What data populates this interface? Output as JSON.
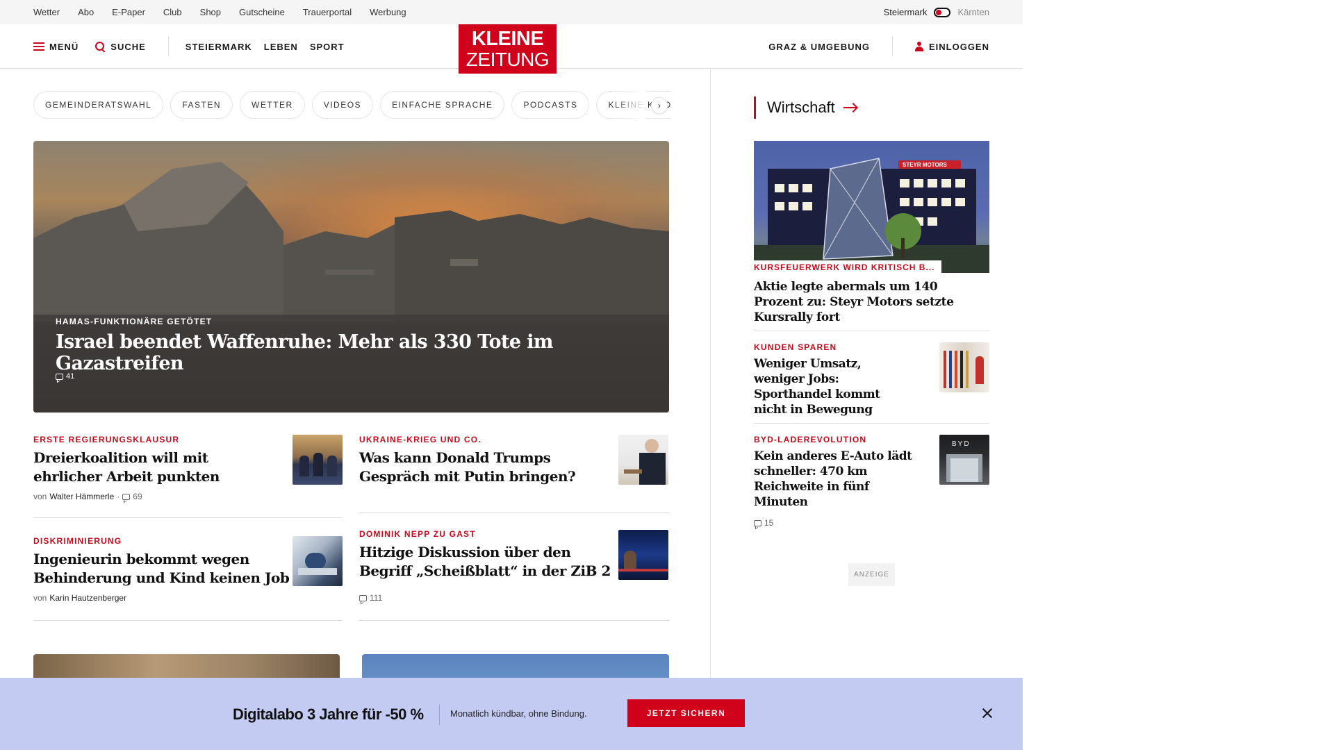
{
  "utility": {
    "links": [
      "Wetter",
      "Abo",
      "E-Paper",
      "Club",
      "Shop",
      "Gutscheine",
      "Trauerportal",
      "Werbung"
    ],
    "region_active": "Steiermark",
    "region_inactive": "Kärnten"
  },
  "nav": {
    "menu_label": "MENÜ",
    "search_label": "SUCHE",
    "sections": [
      "STEIERMARK",
      "LEBEN",
      "SPORT"
    ],
    "logo_line1": "KLEINE",
    "logo_line2": "ZEITUNG",
    "local_label": "GRAZ & UMGEBUNG",
    "login_label": "EINLOGGEN"
  },
  "chips": [
    "GEMEINDERATSWAHL",
    "FASTEN",
    "WETTER",
    "VIDEOS",
    "EINFACHE SPRACHE",
    "PODCASTS",
    "KLEINE KINDE"
  ],
  "chip_arrow": "›",
  "hero": {
    "kicker": "HAMAS-FUNKTIONÄRE GETÖTET",
    "title": "Israel beendet Waffenruhe: Mehr als 330 Tote im Gazastreifen",
    "comments": "41"
  },
  "articles": [
    {
      "kicker": "ERSTE REGIERUNGSKLAUSUR",
      "title_line1": "Dreierkoalition will mit",
      "title_line2": "ehrlicher Arbeit punkten",
      "by": "von",
      "author": "Walter Hämmerle",
      "dot": "·",
      "comments": "69"
    },
    {
      "kicker": "UKRAINE-KRIEG UND CO.",
      "title_line1": "Was kann Donald Trumps",
      "title_line2": "Gespräch mit Putin bringen?"
    },
    {
      "kicker": "DISKRIMINIERUNG",
      "title_line1": "Ingenieurin bekommt wegen",
      "title_line2": "Behinderung und Kind keinen Job",
      "by": "von",
      "author": "Karin Hautzenberger"
    },
    {
      "kicker": "DOMINIK NEPP ZU GAST",
      "title_line1": "Hitzige Diskussion über den",
      "title_line2": "Begriff „Scheißblatt“ in der ZiB 2",
      "comments": "111"
    }
  ],
  "sidebar": {
    "title": "Wirtschaft",
    "main": {
      "kicker": "KURSFEUERWERK WIRD KRITISCH B...",
      "title": "Aktie legte abermals um 140 Prozent zu: Steyr Motors setzte Kursrally fort",
      "sign": "STEYR MOTORS"
    },
    "teasers": [
      {
        "kicker": "KUNDEN SPAREN",
        "title": "Weniger Umsatz, weniger Jobs: Sporthandel kommt nicht in Bewegung"
      },
      {
        "kicker": "BYD-LADEREVOLUTION",
        "title": "Kein anderes E-Auto lädt schneller: 470 km Reichweite in fünf Minuten",
        "comments": "15",
        "logo": "BYD"
      }
    ],
    "ad_label": "ANZEIGE"
  },
  "promo": {
    "title": "Digitalabo 3 Jahre für -50 %",
    "text": "Monatlich kündbar, ohne Bindung.",
    "button": "JETZT SICHERN"
  },
  "colors": {
    "brand_red": "#d0021b",
    "promo_bg": "#c3cbf3"
  }
}
